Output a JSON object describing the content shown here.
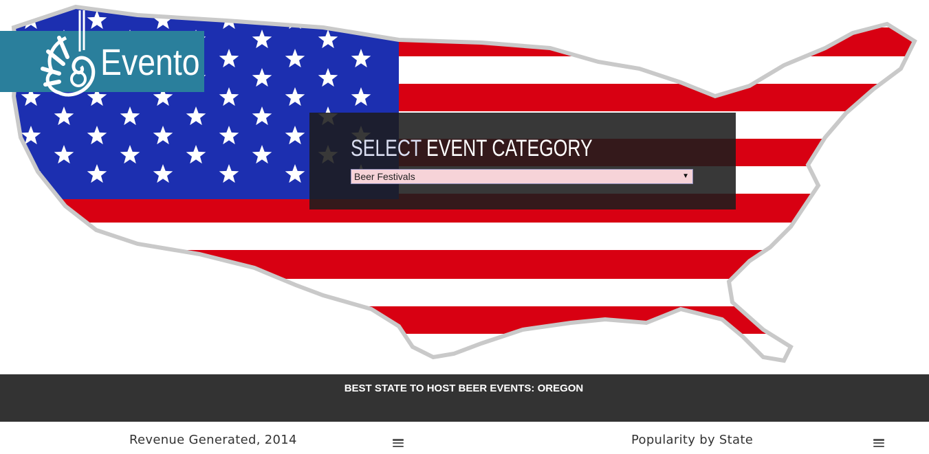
{
  "logo": {
    "brand": "Evento"
  },
  "event_selector": {
    "title_light": "SELECT",
    "title_rest": " EVENT CATEGORY",
    "selected_value": "Beer Festivals"
  },
  "banner": {
    "text": "BEST STATE TO HOST BEER EVENTS: OREGON"
  },
  "charts": [
    {
      "title": "Revenue Generated, 2014"
    },
    {
      "title": "Popularity by State"
    }
  ],
  "colors": {
    "logo_bg": "#2a7f9c",
    "banner_bg": "#333333",
    "panel_bg": "#1c1c1c",
    "flag_red": "#d80012",
    "flag_blue": "#1c2fb0"
  },
  "icons": [
    "logo-mark-icon",
    "dropdown-arrow-icon",
    "menu-icon"
  ]
}
